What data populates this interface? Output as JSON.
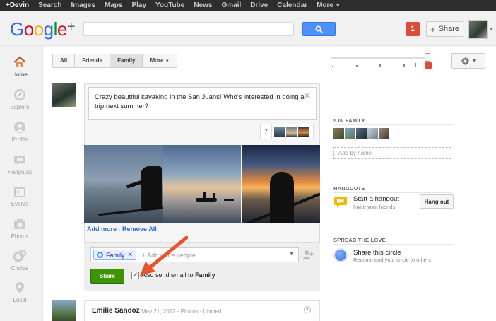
{
  "topbar": {
    "items": [
      "+Devin",
      "Search",
      "Images",
      "Maps",
      "Play",
      "YouTube",
      "News",
      "Gmail",
      "Drive",
      "Calendar",
      "More"
    ]
  },
  "header": {
    "logo_text": "Google+",
    "notification_count": "1",
    "share_label": "Share"
  },
  "leftnav": {
    "items": [
      {
        "label": "Home",
        "icon": "home-icon"
      },
      {
        "label": "Explore",
        "icon": "compass-icon"
      },
      {
        "label": "Profile",
        "icon": "profile-icon"
      },
      {
        "label": "Hangouts",
        "icon": "hangout-icon"
      },
      {
        "label": "Events",
        "icon": "calendar-icon"
      },
      {
        "label": "Photos",
        "icon": "camera-icon"
      },
      {
        "label": "Circles",
        "icon": "circles-icon"
      },
      {
        "label": "Local",
        "icon": "pin-icon"
      }
    ],
    "active_index": 0
  },
  "stream_filters": {
    "tabs": [
      "All",
      "Friends",
      "Family",
      "More"
    ],
    "selected": "Family"
  },
  "volume_slider": {
    "level": 1.0,
    "tick_count": 6
  },
  "composer": {
    "text": "Crazy beautiful kayaking in the San Juans! Who's interested in doing a trip next summer?",
    "photo_count": "7",
    "add_more_label": "Add more",
    "remove_all_label": "Remove All",
    "circle_chip": "Family",
    "people_placeholder": "+ Add more people",
    "share_button": "Share",
    "email_checkbox": {
      "checked": true,
      "label_prefix": "Also send email to",
      "label_circle": "Family"
    }
  },
  "next_post": {
    "author": "Emilie Sandoz",
    "date": "May 21, 2012",
    "category": "Photos",
    "visibility": "Limited"
  },
  "sidebar": {
    "family": {
      "heading": "5 IN FAMILY",
      "add_placeholder": "Add by name"
    },
    "hangouts": {
      "heading": "HANGOUTS",
      "title": "Start a hangout",
      "subtitle": "Invite your friends",
      "button": "Hang out"
    },
    "spread": {
      "heading": "SPREAD THE LOVE",
      "title": "Share this circle",
      "subtitle": "Recommend your circle to others"
    }
  },
  "colors": {
    "accent_blue": "#4d90fe",
    "share_green": "#3d9400",
    "notif_red": "#dd4b39",
    "arrow": "#e8542c"
  }
}
